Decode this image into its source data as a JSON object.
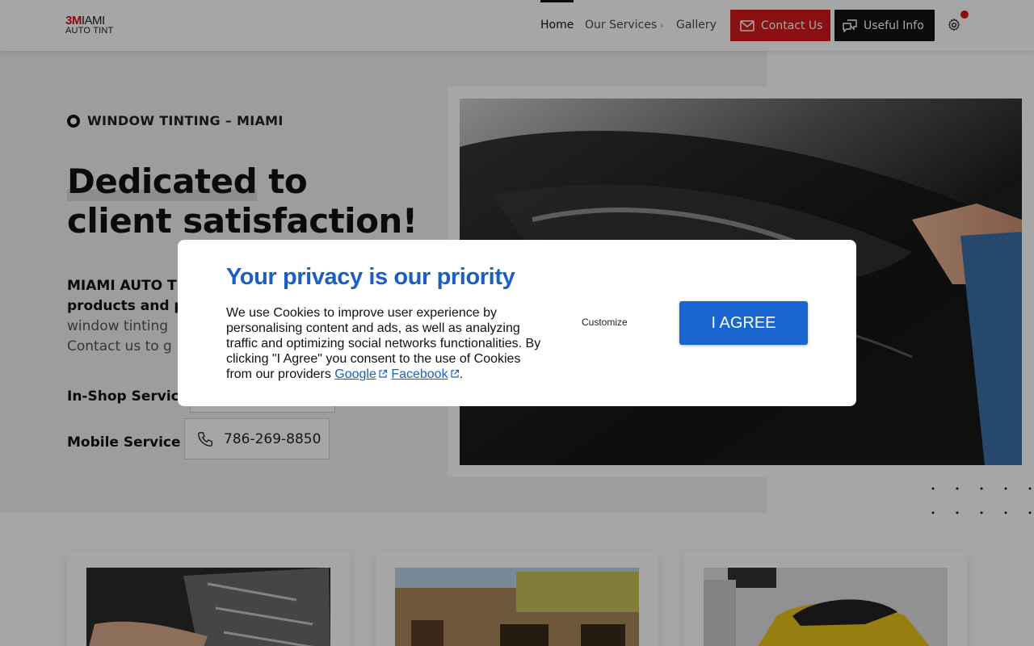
{
  "header": {
    "logo": {
      "line1_brand": "3M",
      "line1_rest": "IAMI",
      "line2": "AUTO TINT"
    },
    "nav": [
      {
        "label": "Home"
      },
      {
        "label": "Our Services"
      },
      {
        "label": "Gallery"
      }
    ],
    "contact_label": "Contact Us",
    "info_label": "Useful Info"
  },
  "hero": {
    "eyebrow": "WINDOW TINTING – MIAMI",
    "headline_highlight": "Dedicated",
    "headline_rest_1": " to",
    "headline_line2": "client satisfaction!",
    "lead_bold_1": "MIAMI AUTO TI",
    "lead_bold_2": "products and p",
    "lead_line3": "window tinting",
    "lead_line4": "Contact us to g",
    "in_shop_label": "In-Shop Service",
    "mobile_label": "Mobile Service :",
    "mobile_phone": "786-269-8850"
  },
  "cookie_modal": {
    "title": "Your privacy is our priority",
    "text": "We use Cookies to improve user experience by personalising content and ads, as well as analyzing traffic and optimizing social networks functionalities. By clicking \"I Agree\" you consent to the use of Cookies from our providers ",
    "link_google": "Google",
    "link_facebook": "Facebook",
    "text_end": ".",
    "customize_label": "Customize",
    "agree_label": "I AGREE"
  },
  "colors": {
    "accent_red": "#d11a1a",
    "modal_blue": "#1a66d1",
    "dark": "#111111"
  },
  "icons": [
    "mail-icon",
    "chat-icon",
    "gear-icon",
    "phone-icon",
    "external-link-icon",
    "chevron-right-icon"
  ]
}
